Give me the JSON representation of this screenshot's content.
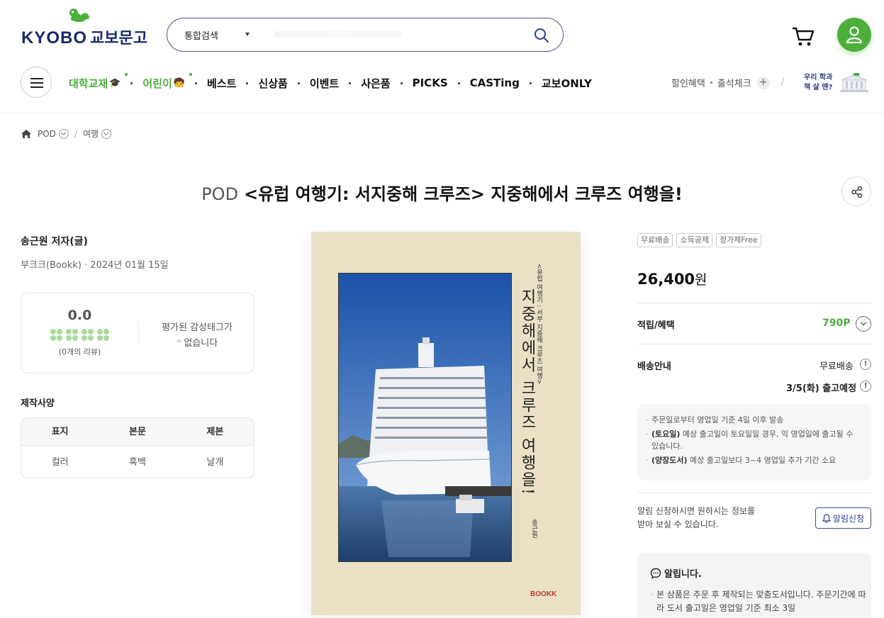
{
  "header": {
    "logo_text": "KYOBO",
    "logo_kr": "교보문고",
    "search": {
      "category": "통합검색",
      "placeholder": ""
    },
    "gnb": [
      {
        "label": "대학교재",
        "emoji": "🎓",
        "green": true,
        "new": true
      },
      {
        "label": "어린이",
        "emoji": "🧒",
        "green": true,
        "new": true
      },
      {
        "label": "베스트",
        "green": false
      },
      {
        "label": "신상품",
        "green": false
      },
      {
        "label": "이벤트",
        "green": false
      },
      {
        "label": "사은품",
        "green": false
      },
      {
        "label": "PICKS",
        "green": false
      },
      {
        "label": "CASTing",
        "green": false
      },
      {
        "label": "교보ONLY",
        "green": false
      }
    ],
    "util": {
      "discount": "할인혜택",
      "attendance": "출석체크",
      "plus": "+",
      "slash": "/"
    },
    "univ": {
      "line1": "우리 학과",
      "line2": "책 살 땐?"
    }
  },
  "breadcrumb": {
    "item1": "POD",
    "sep": "/",
    "item2": "여행"
  },
  "product": {
    "prefix": "POD",
    "title": "<유럽 여행기: 서지중해 크루즈> 지중해에서 크루즈 여행을!",
    "author": "송근원 저자(글)",
    "pubinfo": "부크크(Bookk) · 2024년 01월 15일"
  },
  "review": {
    "score": "0.0",
    "count": "(0개의 리뷰)",
    "tag_line1": "평가된 감성태그가",
    "tag_line2": "없습니다",
    "quote": "❝"
  },
  "spec": {
    "title": "제작사양",
    "headers": [
      "표지",
      "본문",
      "제본"
    ],
    "values": [
      "컬러",
      "흑백",
      "날개"
    ]
  },
  "cover": {
    "side": "<유럽 여행기 : 서부 지중해 크루즈 여행>",
    "title": "지중해에서 크루즈 여행을!",
    "author": "송근원",
    "publisher": "BOOKK"
  },
  "purchase": {
    "badges": [
      "무료배송",
      "소득공제",
      "정가제Free"
    ],
    "price": "26,400",
    "price_unit": "원",
    "points_label": "적립/혜택",
    "points": "790P",
    "ship_label": "배송안내",
    "ship_free": "무료배송",
    "ship_date": "3/5(화) 출고예정",
    "info_mark": "!",
    "ship_notes": [
      {
        "bold": "",
        "text": "주문일로부터 영업일 기준 4일 이후 발송"
      },
      {
        "bold": "(토요일)",
        "text": " 예상 출고일이 토요일일 경우, 익 영업일에 출고될 수 있습니다."
      },
      {
        "bold": "(양장도서)",
        "text": " 예상 출고일보다 3~4 영업일 추가 기간 소요"
      }
    ],
    "alarm_line1": "알림 신청하시면 원하시는 정보를",
    "alarm_line2": "받아 보실 수 있습니다.",
    "alarm_btn": "알림신청",
    "notice_title": "알립니다.",
    "notice_body": "본 상품은 주문 후 제작되는 맞춤도서입니다. 주문기간에 따라 도서 출고일은 영업일 기준 최소 3일"
  },
  "colors": {
    "brand_green": "#4caf3a",
    "brand_navy": "#1a2a6c"
  }
}
